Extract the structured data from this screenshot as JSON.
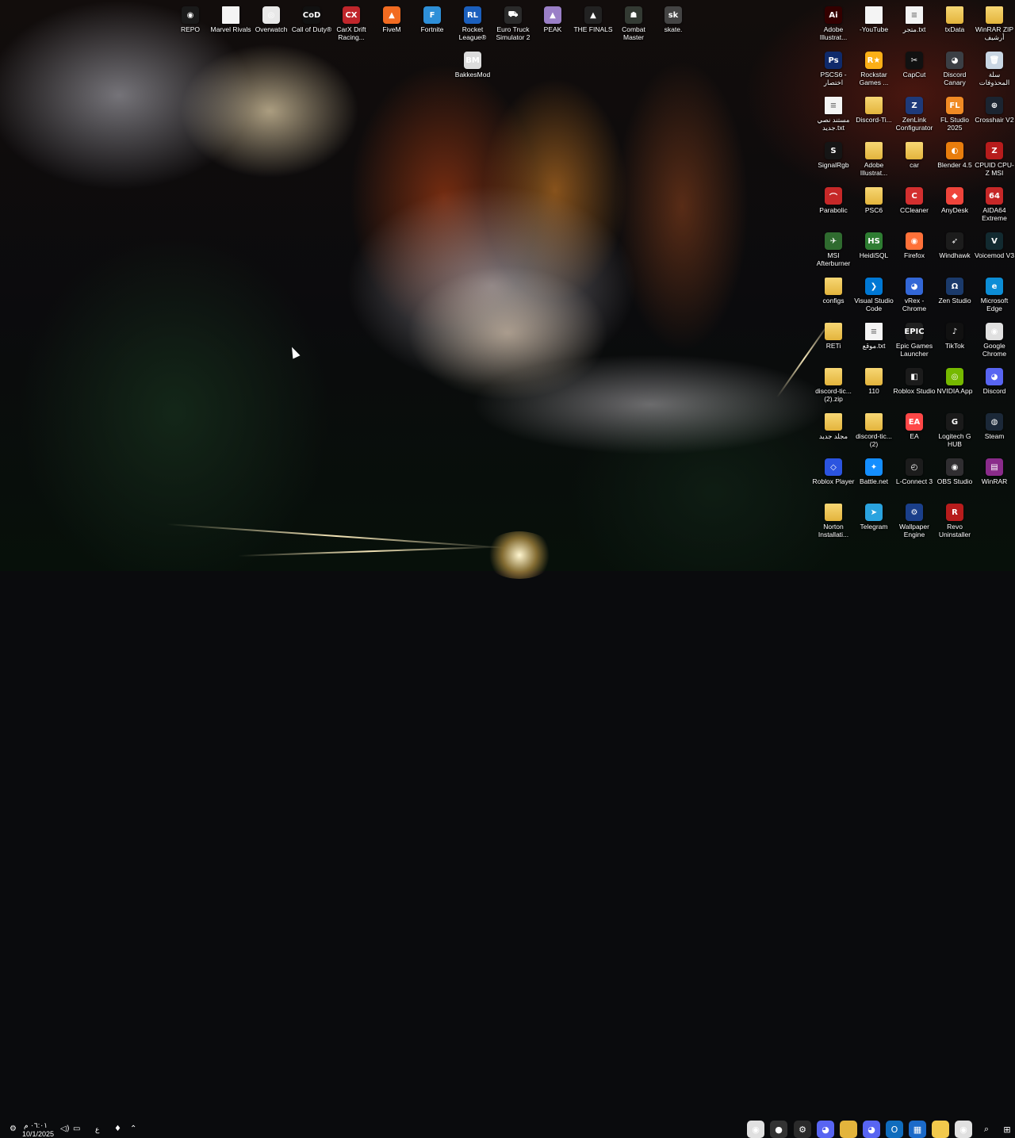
{
  "desktop": {
    "icons": [
      {
        "label": "REPO",
        "icon": "repo-icon",
        "bg": "#1a1a1a",
        "glyph": "◉"
      },
      {
        "label": "Marvel Rivals",
        "icon": "file-icon",
        "bg": "#f4f4f4",
        "glyph": ""
      },
      {
        "label": "Overwatch",
        "icon": "overwatch-icon",
        "bg": "#e8e8e8",
        "glyph": "◎"
      },
      {
        "label": "Call of Duty®",
        "icon": "call-of-duty-icon",
        "bg": "#111111",
        "glyph": "CoD"
      },
      {
        "label": "CarX Drift Racing...",
        "icon": "carx-icon",
        "bg": "#c0262b",
        "glyph": "CX"
      },
      {
        "label": "FiveM",
        "icon": "fivem-icon",
        "bg": "#f26b21",
        "glyph": "▲"
      },
      {
        "label": "Fortnite",
        "icon": "fortnite-icon",
        "bg": "#2e8fd8",
        "glyph": "F"
      },
      {
        "label": "Rocket League®",
        "icon": "rocket-league-icon",
        "bg": "#1b5fbd",
        "glyph": "RL"
      },
      {
        "label": "Euro Truck Simulator 2",
        "icon": "ets2-icon",
        "bg": "#2a2a2a",
        "glyph": "⛟"
      },
      {
        "label": "PEAK",
        "icon": "peak-icon",
        "bg": "#9a7fc7",
        "glyph": "▲"
      },
      {
        "label": "THE FINALS",
        "icon": "the-finals-icon",
        "bg": "#222222",
        "glyph": "▲"
      },
      {
        "label": "Combat Master",
        "icon": "combat-master-icon",
        "bg": "#333a33",
        "glyph": "☗"
      },
      {
        "label": "skate.",
        "icon": "skate-icon",
        "bg": "#444444",
        "glyph": "sk"
      },
      {
        "label": "BakkesMod",
        "icon": "bakkesmod-icon",
        "bg": "#dcdcdc",
        "glyph": "BM"
      },
      {
        "label": "Adobe Illustrat...",
        "icon": "illustrator-icon",
        "bg": "#330000",
        "glyph": "Ai"
      },
      {
        "label": "-YouTube",
        "icon": "file-icon",
        "bg": "#f4f4f4",
        "glyph": ""
      },
      {
        "label": "متجر.txt",
        "icon": "text-file-icon",
        "bg": "#f4f4f4",
        "glyph": "≡"
      },
      {
        "label": "txData",
        "icon": "folder-icon",
        "bg": "folder",
        "glyph": ""
      },
      {
        "label": "WinRAR ZIP أرشيف",
        "icon": "winrar-zip-icon",
        "bg": "folder",
        "glyph": ""
      },
      {
        "label": "PSCS6 - اختصار",
        "icon": "photoshop-icon",
        "bg": "#0f2a6b",
        "glyph": "Ps"
      },
      {
        "label": "Rockstar Games ...",
        "icon": "rockstar-icon",
        "bg": "#fcaf17",
        "glyph": "R★"
      },
      {
        "label": "CapCut",
        "icon": "capcut-icon",
        "bg": "#111111",
        "glyph": "✂"
      },
      {
        "label": "Discord Canary",
        "icon": "discord-canary-icon",
        "bg": "#3b3f45",
        "glyph": "◕"
      },
      {
        "label": "سلة المحذوفات",
        "icon": "recycle-bin-icon",
        "bg": "#c9d6e3",
        "glyph": "🗑"
      },
      {
        "label": "مستند نصي جديد.txt",
        "icon": "text-file-icon",
        "bg": "#f4f4f4",
        "glyph": "≡"
      },
      {
        "label": "Discord-Ti...",
        "icon": "folder-icon",
        "bg": "folder",
        "glyph": ""
      },
      {
        "label": "ZenLink Configurator",
        "icon": "zenlink-icon",
        "bg": "#1e3a7a",
        "glyph": "Z"
      },
      {
        "label": "FL Studio 2025",
        "icon": "fl-studio-icon",
        "bg": "#f08a24",
        "glyph": "FL"
      },
      {
        "label": "Crosshair V2",
        "icon": "crosshair-icon",
        "bg": "#1b2430",
        "glyph": "⊕"
      },
      {
        "label": "SignalRgb",
        "icon": "signalrgb-icon",
        "bg": "#151515",
        "glyph": "S"
      },
      {
        "label": "Adobe Illustrat...",
        "icon": "folder-icon",
        "bg": "folder",
        "glyph": ""
      },
      {
        "label": "car",
        "icon": "folder-icon",
        "bg": "folder",
        "glyph": ""
      },
      {
        "label": "Blender 4.5",
        "icon": "blender-icon",
        "bg": "#e87d0d",
        "glyph": "◐"
      },
      {
        "label": "CPUID CPU-Z MSI",
        "icon": "cpuz-icon",
        "bg": "#b71c1c",
        "glyph": "Z"
      },
      {
        "label": "Parabolic",
        "icon": "parabolic-icon",
        "bg": "#c62828",
        "glyph": "⌒"
      },
      {
        "label": "PSC6",
        "icon": "folder-icon",
        "bg": "folder",
        "glyph": ""
      },
      {
        "label": "CCleaner",
        "icon": "ccleaner-icon",
        "bg": "#d32f2f",
        "glyph": "C"
      },
      {
        "label": "AnyDesk",
        "icon": "anydesk-icon",
        "bg": "#ef443b",
        "glyph": "◆"
      },
      {
        "label": "AIDA64 Extreme",
        "icon": "aida64-icon",
        "bg": "#c62828",
        "glyph": "64"
      },
      {
        "label": "MSI Afterburner",
        "icon": "afterburner-icon",
        "bg": "#2f6b2f",
        "glyph": "✈"
      },
      {
        "label": "HeidiSQL",
        "icon": "heidisql-icon",
        "bg": "#2e7d32",
        "glyph": "HS"
      },
      {
        "label": "Firefox",
        "icon": "firefox-icon",
        "bg": "#ff7139",
        "glyph": "◉"
      },
      {
        "label": "Windhawk",
        "icon": "windhawk-icon",
        "bg": "#1c1c1c",
        "glyph": "➶"
      },
      {
        "label": "Voicemod V3",
        "icon": "voicemod-icon",
        "bg": "#122a30",
        "glyph": "V"
      },
      {
        "label": "configs",
        "icon": "folder-icon",
        "bg": "folder",
        "glyph": ""
      },
      {
        "label": "Visual Studio Code",
        "icon": "vscode-icon",
        "bg": "#0078d4",
        "glyph": "❯"
      },
      {
        "label": "vRex - Chrome",
        "icon": "vrex-icon",
        "bg": "#3367d6",
        "glyph": "◕"
      },
      {
        "label": "Zen Studio",
        "icon": "zen-studio-icon",
        "bg": "#1b3a6b",
        "glyph": "Ω"
      },
      {
        "label": "Microsoft Edge",
        "icon": "edge-icon",
        "bg": "#0c8dd6",
        "glyph": "e"
      },
      {
        "label": "RETi",
        "icon": "folder-icon",
        "bg": "folder",
        "glyph": ""
      },
      {
        "label": "موقع.txt",
        "icon": "text-file-icon",
        "bg": "#f4f4f4",
        "glyph": "≡"
      },
      {
        "label": "Epic Games Launcher",
        "icon": "epic-games-icon",
        "bg": "#202020",
        "glyph": "EPIC"
      },
      {
        "label": "TikTok",
        "icon": "tiktok-icon",
        "bg": "#111111",
        "glyph": "♪"
      },
      {
        "label": "Google Chrome",
        "icon": "chrome-icon",
        "bg": "#e0e0e0",
        "glyph": "◉"
      },
      {
        "label": "discord-tic... (2).zip",
        "icon": "zip-folder-icon",
        "bg": "folder",
        "glyph": ""
      },
      {
        "label": "110",
        "icon": "folder-icon",
        "bg": "folder",
        "glyph": ""
      },
      {
        "label": "Roblox Studio",
        "icon": "roblox-studio-icon",
        "bg": "#1b1b1b",
        "glyph": "◧"
      },
      {
        "label": "NVIDIA App",
        "icon": "nvidia-icon",
        "bg": "#76b900",
        "glyph": "◎"
      },
      {
        "label": "Discord",
        "icon": "discord-icon",
        "bg": "#5865f2",
        "glyph": "◕"
      },
      {
        "label": "مجلد جديد",
        "icon": "folder-icon",
        "bg": "folder",
        "glyph": ""
      },
      {
        "label": "discord-tic... (2)",
        "icon": "folder-icon",
        "bg": "folder",
        "glyph": ""
      },
      {
        "label": "EA",
        "icon": "ea-icon",
        "bg": "#ff4747",
        "glyph": "EA"
      },
      {
        "label": "Logitech G HUB",
        "icon": "logitech-icon",
        "bg": "#1a1a1a",
        "glyph": "G"
      },
      {
        "label": "Steam",
        "icon": "steam-icon",
        "bg": "#1b2838",
        "glyph": "◍"
      },
      {
        "label": "Roblox Player",
        "icon": "roblox-icon",
        "bg": "#2b54e0",
        "glyph": "◇"
      },
      {
        "label": "Battle.net",
        "icon": "battlenet-icon",
        "bg": "#148eff",
        "glyph": "✦"
      },
      {
        "label": "L-Connect 3",
        "icon": "lconnect-icon",
        "bg": "#1c1c1c",
        "glyph": "◴"
      },
      {
        "label": "OBS Studio",
        "icon": "obs-icon",
        "bg": "#302e31",
        "glyph": "◉"
      },
      {
        "label": "WinRAR",
        "icon": "winrar-icon",
        "bg": "#8a2b8a",
        "glyph": "▤"
      },
      {
        "label": "Norton Installati...",
        "icon": "folder-icon",
        "bg": "folder",
        "glyph": ""
      },
      {
        "label": "Telegram",
        "icon": "telegram-icon",
        "bg": "#2aa3df",
        "glyph": "➤"
      },
      {
        "label": "Wallpaper Engine",
        "icon": "wallpaper-engine-icon",
        "bg": "#1a3f8a",
        "glyph": "⚙"
      },
      {
        "label": "Revo Uninstaller",
        "icon": "revo-icon",
        "bg": "#b71c1c",
        "glyph": "R"
      }
    ]
  },
  "taskbar": {
    "clock_time": "٠٦:٠١ م",
    "clock_date": "10/1/2025",
    "lang": "ع",
    "pinned": [
      {
        "icon": "chrome-icon",
        "bg": "#e0e0e0",
        "glyph": "◉"
      },
      {
        "icon": "record-icon",
        "bg": "#333333",
        "glyph": "●"
      },
      {
        "icon": "settings-icon",
        "bg": "#2a2a2a",
        "glyph": "⚙"
      },
      {
        "icon": "discord-icon",
        "bg": "#5865f2",
        "glyph": "◕"
      },
      {
        "icon": "folder-icon",
        "bg": "#e3b43c",
        "glyph": ""
      },
      {
        "icon": "discord-icon",
        "bg": "#5865f2",
        "glyph": "◕"
      },
      {
        "icon": "outlook-icon",
        "bg": "#0f6cbd",
        "glyph": "O"
      },
      {
        "icon": "store-icon",
        "bg": "#1b6ac9",
        "glyph": "▦"
      },
      {
        "icon": "file-explorer-icon",
        "bg": "#f2c94c",
        "glyph": ""
      },
      {
        "icon": "chrome-icon",
        "bg": "#e0e0e0",
        "glyph": "◉"
      },
      {
        "icon": "search-icon",
        "bg": "transparent",
        "glyph": "⌕"
      },
      {
        "icon": "start-icon",
        "bg": "transparent",
        "glyph": "⊞"
      }
    ]
  }
}
